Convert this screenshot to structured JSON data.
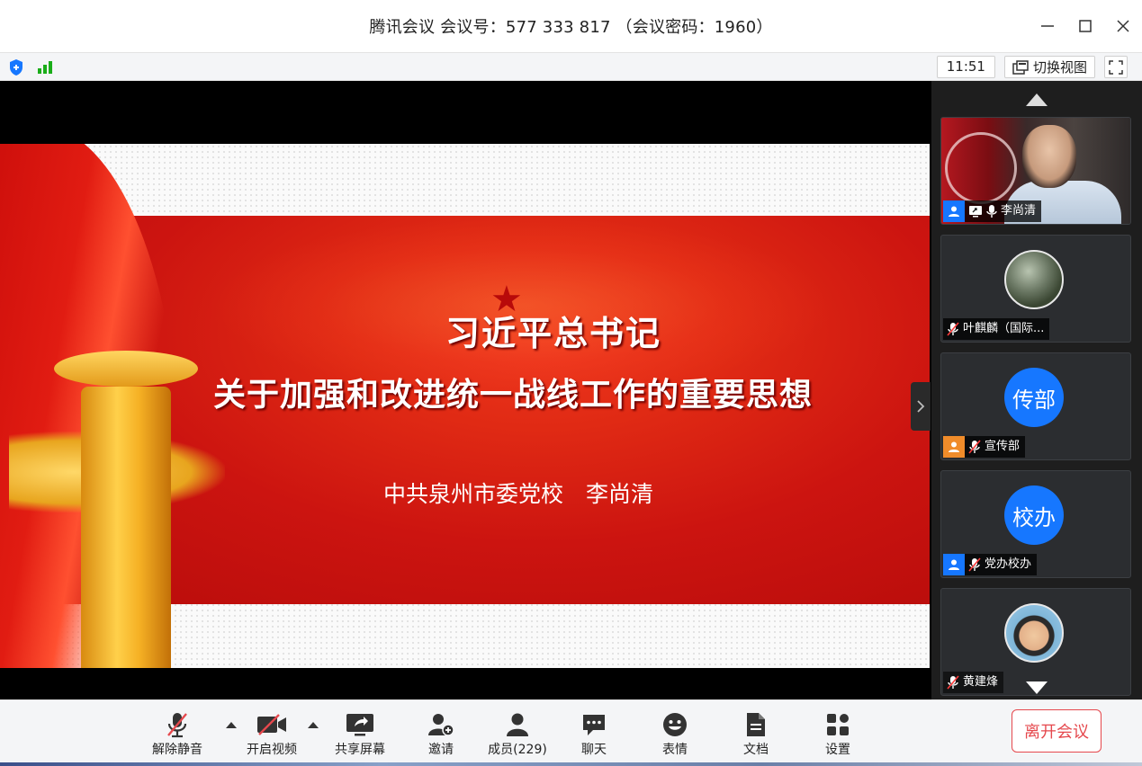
{
  "window": {
    "title": "腾讯会议 会议号：577 333 817 （会议密码：1960）"
  },
  "statusbar": {
    "time": "11:51",
    "switch_view_label": "切换视图"
  },
  "slide": {
    "title_line1": "习近平总书记",
    "title_line2": "关于加强和改进统一战线工作的重要思想",
    "subtitle": "中共泉州市委党校　李尚清"
  },
  "participants": [
    {
      "name": "李尚清",
      "type": "video"
    },
    {
      "name": "叶麒麟（国际...",
      "type": "photo"
    },
    {
      "name": "宣传部",
      "type": "avatar",
      "avatar_text": "传部",
      "avatar_color": "#1677ff"
    },
    {
      "name": "党办校办",
      "type": "avatar",
      "avatar_text": "校办",
      "avatar_color": "#1677ff"
    },
    {
      "name": "黄建烽",
      "type": "photo"
    }
  ],
  "toolbar": {
    "unmute": "解除静音",
    "start_video": "开启视频",
    "share_screen": "共享屏幕",
    "invite": "邀请",
    "members": "成员(229)",
    "chat": "聊天",
    "reactions": "表情",
    "docs": "文档",
    "settings": "设置",
    "leave": "离开会议"
  },
  "colors": {
    "accent": "#1677ff",
    "leave": "#e5484d",
    "signal": "#1aad19"
  }
}
